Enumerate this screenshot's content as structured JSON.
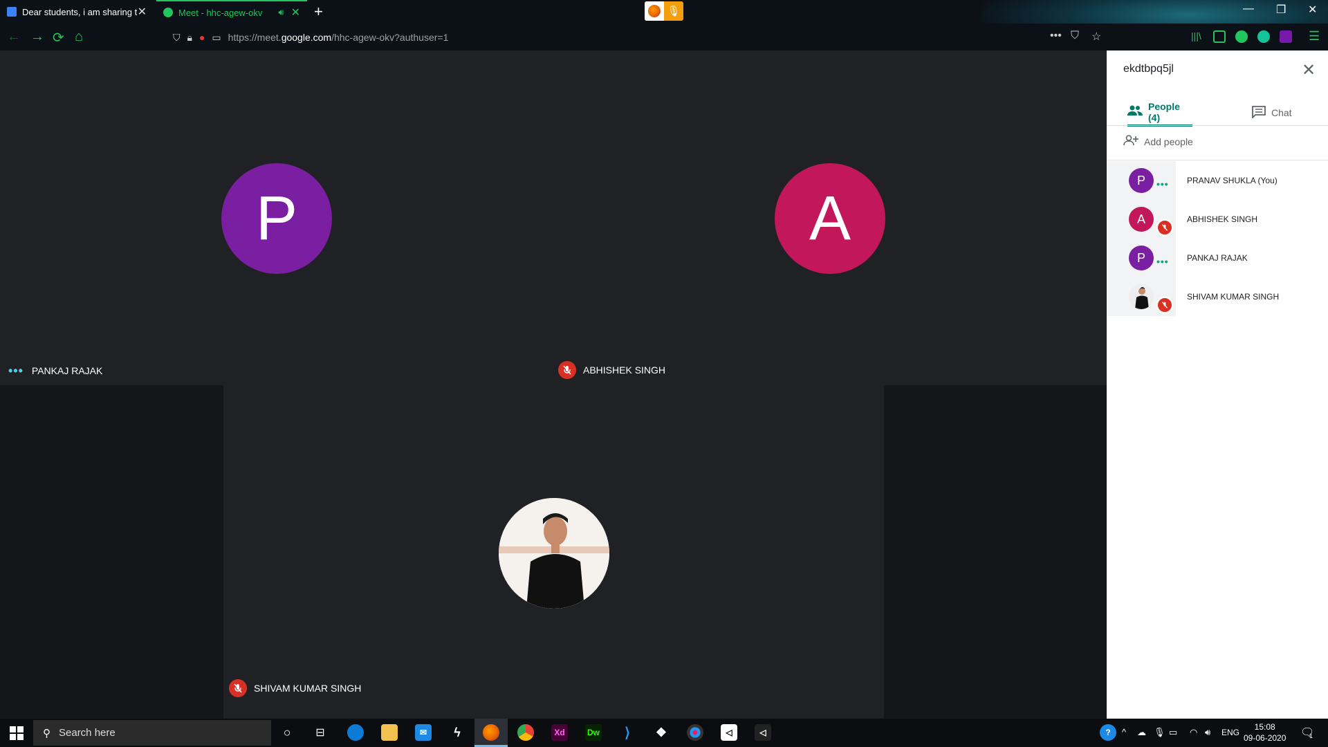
{
  "browser": {
    "tabs": [
      {
        "title": "Dear students, i am sharing th",
        "favicon": "classroom-icon",
        "active": false
      },
      {
        "title": "Meet - hhc-agew-okv",
        "favicon": "meet-icon",
        "active": true
      }
    ],
    "url_prefix": "https://meet.",
    "url_host": "google.com",
    "url_path": "/hhc-agew-okv?authuser=1"
  },
  "stage": {
    "tiles": [
      {
        "name": "PANKAJ RAJAK",
        "initial": "P",
        "color": "#7b1fa2",
        "status": "speaking-dots"
      },
      {
        "name": "ABHISHEK SINGH",
        "initial": "A",
        "color": "#c2185b",
        "status": "muted"
      },
      {
        "name": "SHIVAM KUMAR SINGH",
        "initial": "",
        "color": "#ffffff",
        "status": "muted"
      }
    ]
  },
  "panel": {
    "meeting_code": "ekdtbpq5jl",
    "tab_people": "People (4)",
    "tab_chat": "Chat",
    "add_people": "Add people",
    "participants": [
      {
        "name": "PRANAV SHUKLA (You)",
        "initial": "P",
        "color": "#7b1fa2",
        "status": "dots"
      },
      {
        "name": "ABHISHEK SINGH",
        "initial": "A",
        "color": "#c2185b",
        "status": "muted"
      },
      {
        "name": "PANKAJ RAJAK",
        "initial": "P",
        "color": "#7b1fa2",
        "status": "dots"
      },
      {
        "name": "SHIVAM KUMAR SINGH",
        "initial": "",
        "color": "#eeeeee",
        "status": "muted"
      }
    ]
  },
  "taskbar": {
    "search_placeholder": "Search here",
    "language": "ENG",
    "time": "15:08",
    "date": "09-06-2020",
    "notification_count": "1"
  }
}
